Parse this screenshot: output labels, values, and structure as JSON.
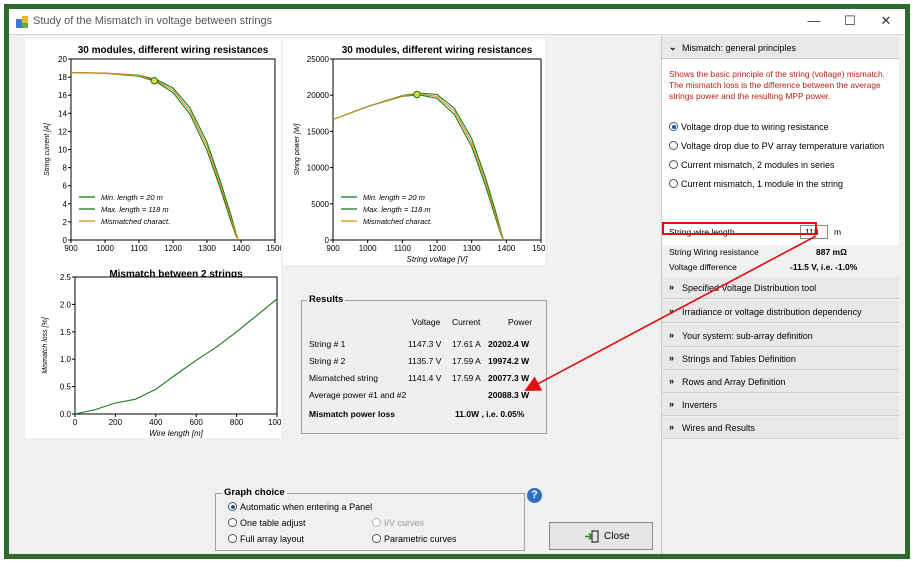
{
  "window": {
    "title": "Study of the Mismatch in voltage between strings",
    "minimize": "—",
    "maximize": "☐",
    "close": "✕"
  },
  "plot1": {
    "title": "30 modules, different wiring resistances",
    "ylabel": "String current [A]",
    "yticks": [
      "20",
      "18",
      "16",
      "14",
      "12",
      "10",
      "8",
      "6",
      "4",
      "2",
      "0"
    ],
    "xticks": [
      "900",
      "1000",
      "1100",
      "1200",
      "1300",
      "1400",
      "1500"
    ],
    "legend": [
      "Min. length = 20 m",
      "Max. length = 118 m",
      "Mismatched charact."
    ]
  },
  "plot2": {
    "title": "30 modules, different wiring resistances",
    "ylabel": "String power [W]",
    "xlabel": "String voltage [V]",
    "yticks": [
      "25000",
      "20000",
      "15000",
      "10000",
      "5000",
      "0"
    ],
    "xticks": [
      "900",
      "1000",
      "1100",
      "1200",
      "1300",
      "1400",
      "1500"
    ],
    "legend": [
      "Min. length = 20 m",
      "Max. length = 118 m",
      "Mismatched charact."
    ]
  },
  "plot3": {
    "title": "Mismatch between 2 strings",
    "ylabel": "Mismatch loss [%]",
    "xlabel": "Wire length [m]",
    "yticks": [
      "2.5",
      "2.0",
      "1.5",
      "1.0",
      "0.5",
      "0.0"
    ],
    "xticks": [
      "0",
      "200",
      "400",
      "600",
      "800",
      "1000"
    ]
  },
  "chart_data": [
    {
      "type": "line",
      "title": "30 modules, different wiring resistances",
      "ylabel": "String current [A]",
      "xlim": [
        900,
        1500
      ],
      "ylim": [
        0,
        20
      ],
      "legend_placement": "bottom-left",
      "series": [
        {
          "name": "Min. length = 20 m",
          "color": "#1a7a1a",
          "x": [
            900,
            1000,
            1100,
            1150,
            1200,
            1250,
            1300,
            1340,
            1370,
            1385,
            1392
          ],
          "y": [
            18.5,
            18.45,
            18.2,
            17.75,
            16.8,
            14.6,
            10.8,
            6.4,
            2.8,
            0.8,
            0
          ]
        },
        {
          "name": "Max. length = 118 m",
          "color": "#1a7a1a",
          "x": [
            900,
            1000,
            1100,
            1150,
            1200,
            1250,
            1300,
            1340,
            1370,
            1385,
            1392
          ],
          "y": [
            18.5,
            18.42,
            18.1,
            17.5,
            16.3,
            13.9,
            9.9,
            5.6,
            2.1,
            0.5,
            0
          ]
        },
        {
          "name": "Mismatched charact.",
          "color": "#e38a1c",
          "x": [
            900,
            1000,
            1100,
            1150,
            1200,
            1250,
            1300,
            1340,
            1370,
            1385,
            1392
          ],
          "y": [
            18.5,
            18.43,
            18.15,
            17.62,
            16.55,
            14.25,
            10.35,
            6.0,
            2.45,
            0.65,
            0
          ]
        }
      ]
    },
    {
      "type": "line",
      "title": "30 modules, different wiring resistances",
      "xlabel": "String voltage [V]",
      "ylabel": "String power [W]",
      "xlim": [
        900,
        1500
      ],
      "ylim": [
        0,
        25000
      ],
      "legend_placement": "bottom-left",
      "series": [
        {
          "name": "Min. length = 20 m",
          "color": "#1a7a1a",
          "x": [
            900,
            1000,
            1100,
            1150,
            1200,
            1250,
            1300,
            1340,
            1370,
            1385,
            1392
          ],
          "y": [
            16650,
            18450,
            19950,
            20300,
            20100,
            18200,
            14000,
            8600,
            3800,
            1100,
            0
          ]
        },
        {
          "name": "Max. length = 118 m",
          "color": "#1a7a1a",
          "x": [
            900,
            1000,
            1100,
            1150,
            1200,
            1250,
            1300,
            1340,
            1370,
            1385,
            1392
          ],
          "y": [
            16650,
            18420,
            19850,
            20050,
            19550,
            17350,
            12900,
            7500,
            2900,
            700,
            0
          ]
        },
        {
          "name": "Mismatched charact.",
          "color": "#e38a1c",
          "x": [
            900,
            1000,
            1100,
            1150,
            1200,
            1250,
            1300,
            1340,
            1370,
            1385,
            1392
          ],
          "y": [
            16650,
            18430,
            19900,
            20170,
            19830,
            17800,
            13450,
            8050,
            3350,
            900,
            0
          ]
        }
      ]
    },
    {
      "type": "line",
      "title": "Mismatch between 2 strings",
      "xlabel": "Wire length [m]",
      "ylabel": "Mismatch loss [%]",
      "xlim": [
        0,
        1000
      ],
      "ylim": [
        0,
        2.5
      ],
      "series": [
        {
          "name": "",
          "color": "#1a7a1a",
          "x": [
            0,
            100,
            200,
            300,
            400,
            500,
            600,
            700,
            800,
            900,
            1000
          ],
          "y": [
            0.0,
            0.08,
            0.2,
            0.27,
            0.45,
            0.72,
            0.98,
            1.22,
            1.5,
            1.8,
            2.1
          ]
        }
      ]
    }
  ],
  "results": {
    "legend": "Results",
    "headers": [
      "Voltage",
      "Current",
      "Power"
    ],
    "rows": [
      {
        "label": "String # 1",
        "voltage": "1147.3 V",
        "current": "17.61 A",
        "power": "20202.4 W"
      },
      {
        "label": "String # 2",
        "voltage": "1135.7 V",
        "current": "17.59 A",
        "power": "19974.2 W"
      },
      {
        "label": "Mismatched string",
        "voltage": "1141.4 V",
        "current": "17.59 A",
        "power": "20077.3 W"
      }
    ],
    "average_label": "Average power #1 and #2",
    "average_value": "20088.3 W",
    "loss_label": "Mismatch power loss",
    "loss_value": "11.0W , i.e. 0.05%"
  },
  "graph_choice": {
    "legend": "Graph choice",
    "options": {
      "automatic": "Automatic when entering a Panel",
      "one_table": "One table adjust",
      "full_array": "Full array layout",
      "iv_curves": "I/V curves",
      "parametric": "Parametric curves"
    }
  },
  "close_label": "Close",
  "help_glyph": "?",
  "right_panel": {
    "principles_header": "Mismatch: general principles",
    "description": "Shows the basic principle of the string (voltage) mismatch. The mismatch loss is the difference between the average strings power and the resulting MPP power.",
    "options": [
      "Voltage drop due to wiring resistance",
      "Voltage drop due to PV array temperature variation",
      "Current mismatch, 2 modules in series",
      "Current mismatch, 1 module in the string"
    ],
    "wire_length_label": "String wire length",
    "wire_length_value": "118",
    "wire_length_unit": "m",
    "resistance_label": "String Wiring resistance",
    "resistance_value": "887 mΩ",
    "voltage_diff_label": "Voltage difference",
    "voltage_diff_value": "-11.5 V, i.e. -1.0%",
    "sections": [
      "Specified Voltage Distribution tool",
      "Irradiance or voltage distribution dependency",
      "Your system: sub-array definition",
      "Strings and Tables Definition",
      "Rows and Array Definition",
      "Inverters",
      "Wires and Results"
    ]
  },
  "colors": {
    "frame": "#2e6b2a",
    "curve_green": "#1a7a1a",
    "curve_orange": "#e38a1c",
    "description_red": "#b8221a",
    "highlight_red": "#e01010"
  },
  "icons": {
    "app": "pvsyst-icon",
    "close_button": "exit-door-icon",
    "accordion": "chevron-icon"
  }
}
